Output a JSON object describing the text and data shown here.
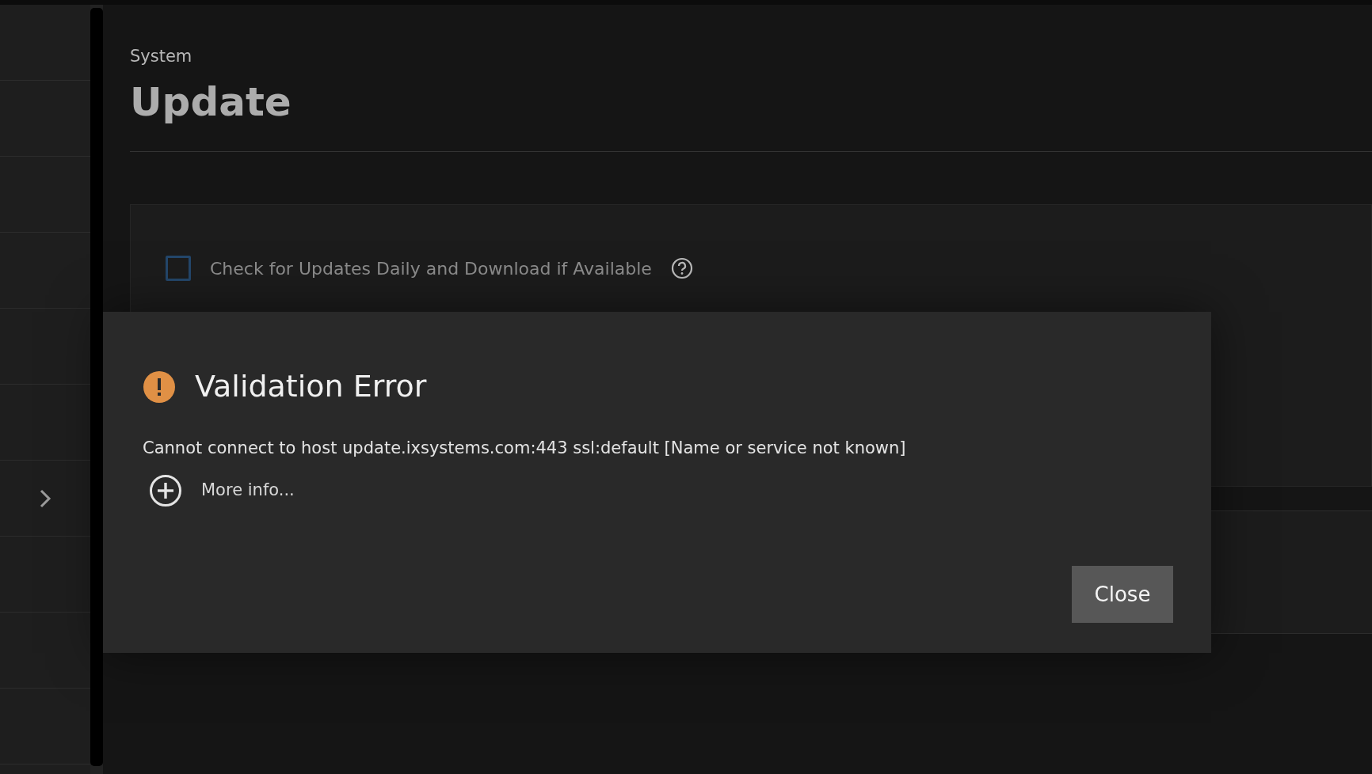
{
  "page": {
    "breadcrumb": "System",
    "title": "Update"
  },
  "settings": {
    "auto_update": {
      "label": "Check for Updates Daily and Download if Available",
      "checked": false
    }
  },
  "dialog": {
    "title": "Validation Error",
    "message": "Cannot connect to host update.ixsystems.com:443 ssl:default [Name or service not known]",
    "more_info": "More info...",
    "expanded": false,
    "buttons": [
      "Close"
    ]
  }
}
